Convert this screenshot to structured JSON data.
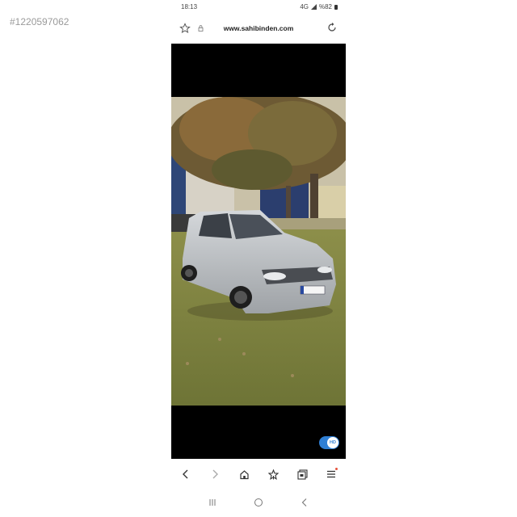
{
  "watermark": "#1220597062",
  "status_bar": {
    "time": "18:13",
    "network": "4G",
    "battery": "%82"
  },
  "address_bar": {
    "url": "www.sahibinden.com"
  },
  "viewer": {
    "hd_label": "HD",
    "hd_enabled": true
  },
  "icons": {
    "top": [
      "star-icon",
      "lock-icon",
      "reload-icon"
    ],
    "browser_nav": [
      "back-icon",
      "forward-icon",
      "home-icon",
      "bookmark-icon",
      "tabs-icon",
      "menu-icon"
    ],
    "system_nav": [
      "recents-icon",
      "home-circle-icon",
      "system-back-icon"
    ]
  },
  "colors": {
    "hd_toggle": "#2f7fd4",
    "menu_badge": "#e5533c",
    "viewer_background": "#000000"
  }
}
